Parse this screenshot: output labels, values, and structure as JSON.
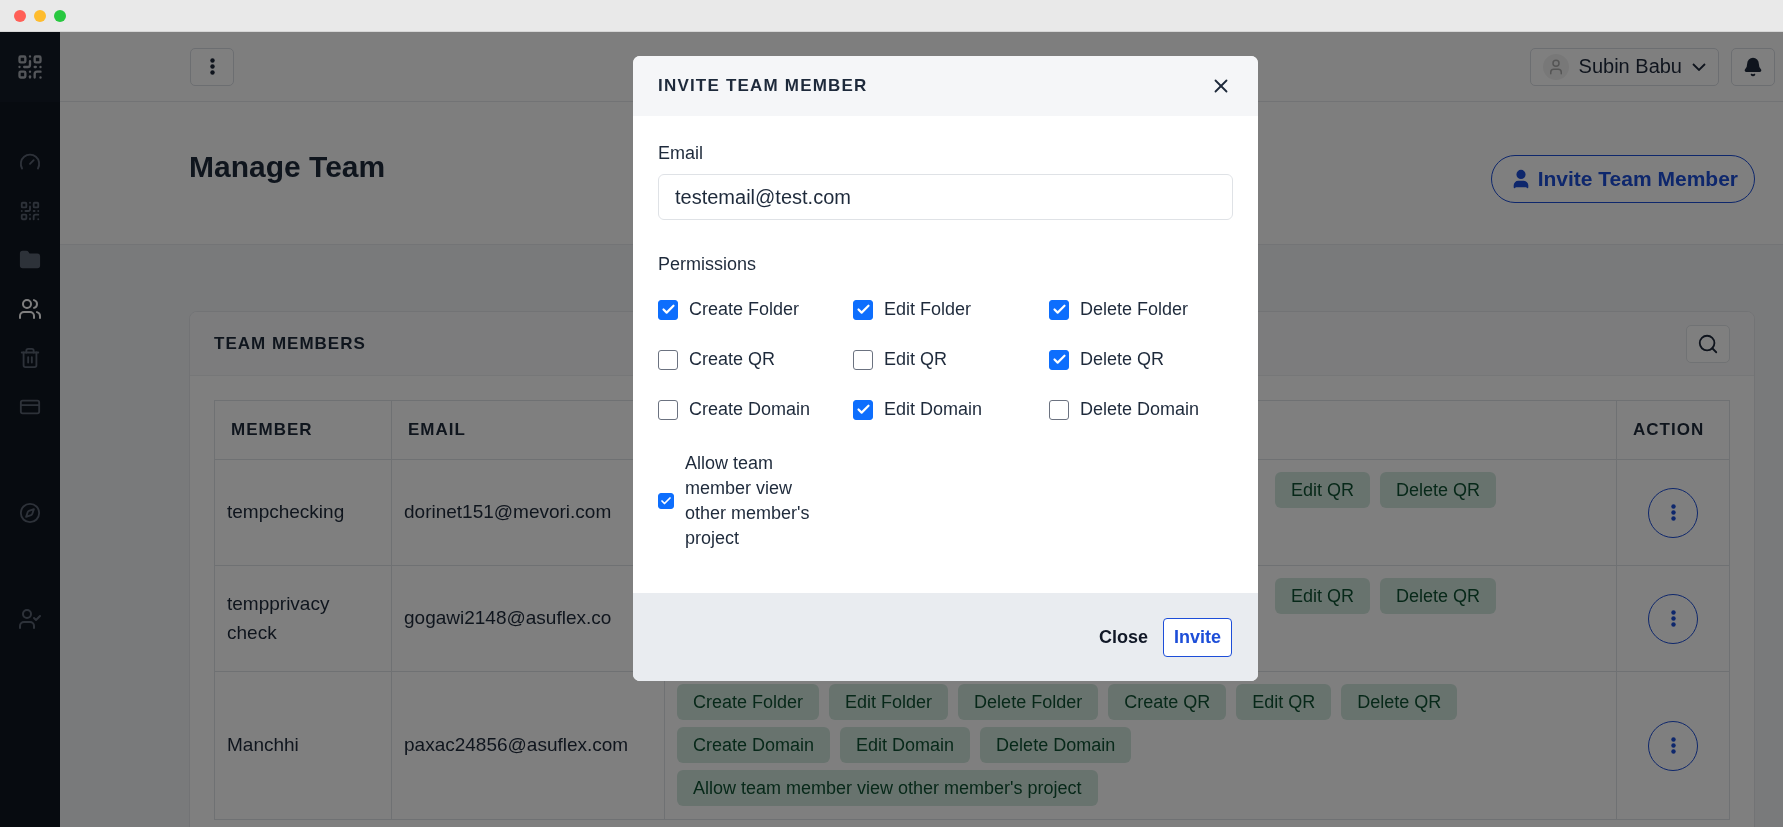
{
  "sidebar": {
    "items": [
      {
        "kind": "logo",
        "selected": false
      },
      {
        "kind": "dashboard",
        "selected": false
      },
      {
        "kind": "qr",
        "selected": false
      },
      {
        "kind": "folder",
        "selected": false
      },
      {
        "kind": "team",
        "selected": true
      },
      {
        "kind": "trash",
        "selected": false
      },
      {
        "kind": "billing",
        "selected": false
      },
      {
        "kind": "explore",
        "selected": false
      },
      {
        "kind": "account",
        "selected": false
      }
    ]
  },
  "topbar": {
    "user": "Subin Babu"
  },
  "page": {
    "title": "Manage Team",
    "action": "Invite Team Member"
  },
  "team_card": {
    "title": "TEAM MEMBERS",
    "table": {
      "columns": [
        "MEMBER",
        "EMAIL",
        "ACTION"
      ],
      "rows": [
        {
          "member": "tempchecking",
          "email": "dorinet151@mevori.com",
          "permission_groups": [
            [
              "Edit QR",
              "Delete QR"
            ]
          ]
        },
        {
          "member": "tempprivacy check",
          "email": "gogawi2148@asuflex.co",
          "permission_groups": [
            [
              "Edit QR",
              "Delete QR"
            ]
          ]
        },
        {
          "member": "Manchhi",
          "email": "paxac24856@asuflex.com",
          "permission_groups": [
            [
              "Create Folder",
              "Edit Folder",
              "Delete Folder",
              "Create QR",
              "Edit QR",
              "Delete QR"
            ],
            [
              "Create Domain",
              "Edit Domain",
              "Delete Domain"
            ],
            [
              "Allow team member view other member's project"
            ]
          ]
        }
      ]
    }
  },
  "modal": {
    "title": "INVITE TEAM MEMBER",
    "email_label": "Email",
    "email_value": "testemail@test.com",
    "permissions_label": "Permissions",
    "permissions": [
      {
        "label": "Create Folder",
        "checked": true
      },
      {
        "label": "Edit Folder",
        "checked": true
      },
      {
        "label": "Delete Folder",
        "checked": true
      },
      {
        "label": "Create QR",
        "checked": false
      },
      {
        "label": "Edit QR",
        "checked": false
      },
      {
        "label": "Delete QR",
        "checked": true
      },
      {
        "label": "Create Domain",
        "checked": false
      },
      {
        "label": "Edit Domain",
        "checked": true
      },
      {
        "label": "Delete Domain",
        "checked": false
      }
    ],
    "view_permission": {
      "label": "Allow team member view other member's project",
      "checked": true
    },
    "close_button": "Close",
    "invite_button": "Invite"
  }
}
